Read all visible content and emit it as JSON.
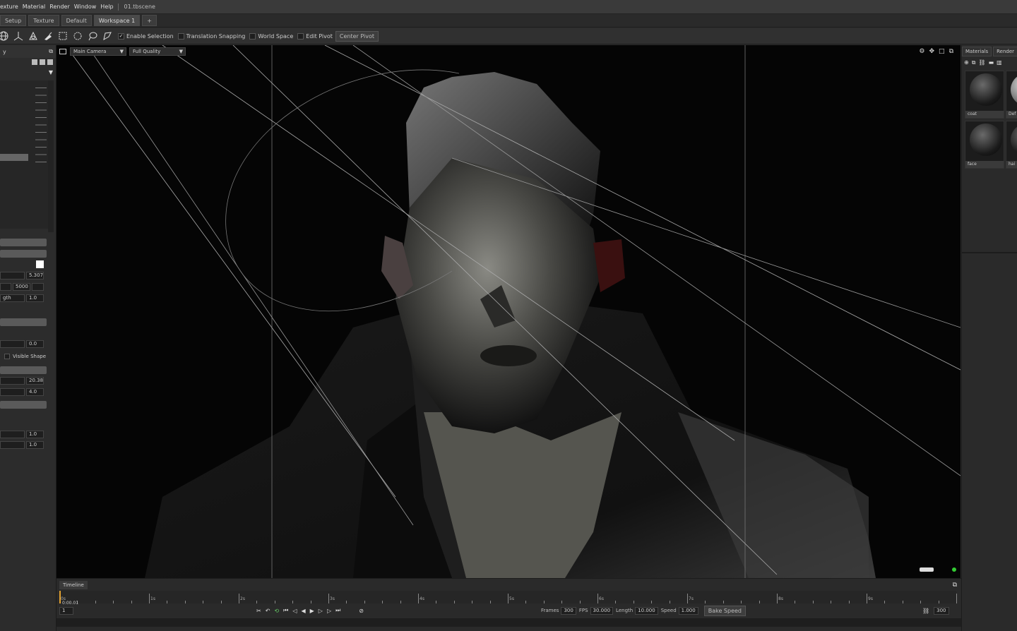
{
  "menubar": {
    "items": [
      "exture",
      "Material",
      "Render",
      "Window",
      "Help"
    ],
    "filename": "01.tbscene"
  },
  "tabs": [
    {
      "label": "Setup"
    },
    {
      "label": "Texture"
    },
    {
      "label": "Default"
    },
    {
      "label": "Workspace 1"
    },
    {
      "label": "+"
    }
  ],
  "toolbar": {
    "enable_selection": "Enable Selection",
    "translation_snapping": "Translation Snapping",
    "world_space": "World Space",
    "edit_pivot": "Edit Pivot",
    "center_pivot": "Center Pivot"
  },
  "left_panel": {
    "header": "y",
    "fields": {
      "f1": "5.307",
      "f2": "5000",
      "f3": "1.0",
      "f4": "0.0",
      "f5": "20.38",
      "f6": "4.0",
      "f7": "1.0",
      "f8": "1.0"
    },
    "labels": {
      "gth": "gth",
      "visible_shape": "Visible Shape"
    }
  },
  "viewport": {
    "camera": "Main Camera",
    "quality": "Full Quality"
  },
  "right_panel": {
    "tabs": [
      "Materials",
      "Render"
    ],
    "materials": [
      {
        "label": "coat"
      },
      {
        "label": "Def"
      },
      {
        "label": "face"
      },
      {
        "label": "hai"
      }
    ]
  },
  "timeline": {
    "title": "Timeline",
    "time_readout": "0:00.01",
    "current_frame": "1",
    "ruler_labels": [
      "0s",
      "1s",
      "2s",
      "3s",
      "4s",
      "5s",
      "6s",
      "7s",
      "8s",
      "9s"
    ],
    "frames_label": "Frames",
    "frames": "300",
    "fps_label": "FPS",
    "fps": "30.000",
    "length_label": "Length",
    "length": "10.000",
    "speed_label": "Speed",
    "speed": "1.000",
    "bake_speed": "Bake Speed",
    "end_frame": "300"
  }
}
